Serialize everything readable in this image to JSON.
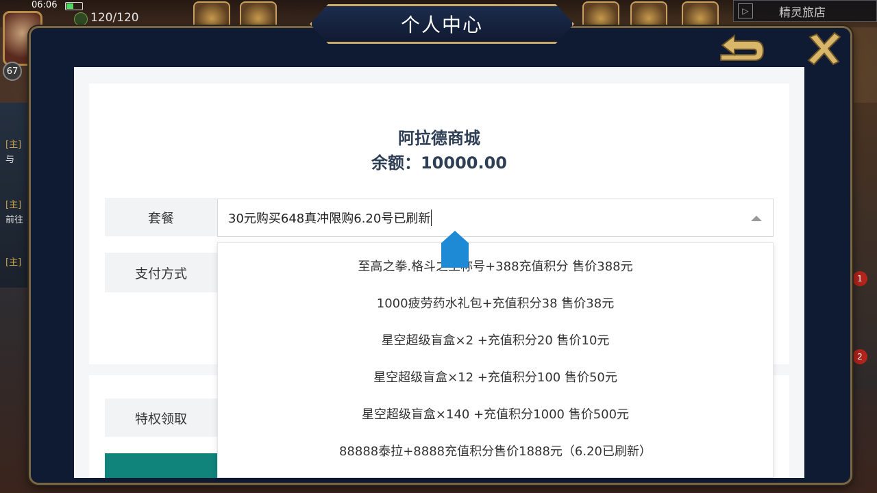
{
  "status": {
    "time": "06:06"
  },
  "player": {
    "level": "67",
    "stamina": "120/120"
  },
  "top_right": {
    "label": "精灵旅店"
  },
  "left_side_tags": [
    "[主]",
    "与",
    "[主]",
    "前往",
    "[主]"
  ],
  "right_side_badges": [
    "1",
    "2"
  ],
  "modal": {
    "title": "个人中心"
  },
  "shop": {
    "name": "阿拉德商城",
    "balance": "余额：10000.00",
    "package_label": "套餐",
    "payment_label": "支付方式",
    "privilege_label": "特权领取",
    "selected_package": "30元购买648真冲限购6.20号已刷新"
  },
  "dropdown": {
    "options": [
      "至高之拳.格斗之王称号+388充值积分 售价388元",
      "1000疲劳药水礼包+充值积分38 售价38元",
      "星空超级盲盒×2 +充值积分20 售价10元",
      "星空超级盲盒×12 +充值积分100 售价50元",
      "星空超级盲盒×140 +充值积分1000 售价500元",
      "88888泰拉+8888充值积分售价1888元（6.20已刷新）"
    ]
  },
  "colors": {
    "modal_bg": "#0f1b33",
    "frame_gold": "#c9aa6a",
    "text_dark": "#2d3e55",
    "accent_green": "#10847a",
    "cursor_blue": "#1e8ad6"
  }
}
